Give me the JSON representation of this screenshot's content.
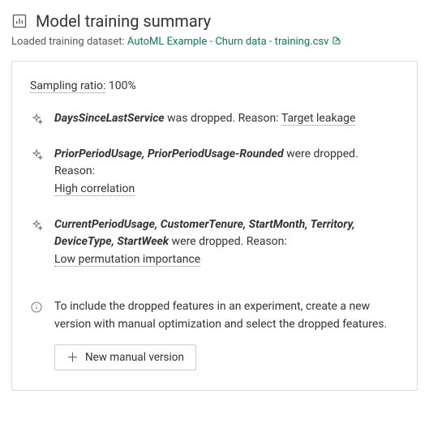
{
  "header": {
    "title": "Model training summary",
    "dataset_label": "Loaded training dataset:",
    "dataset_name": "AutoML Example - Churn data - training.csv"
  },
  "sampling": {
    "label": "Sampling ratio:",
    "value": "100%"
  },
  "drops": [
    {
      "features": "DaysSinceLastService",
      "verb": "was dropped. Reason:",
      "reason": "Target leakage",
      "reason_inline": true
    },
    {
      "features": "PriorPeriodUsage, PriorPeriodUsage-Rounded",
      "verb": "were dropped. Reason:",
      "reason": "High correlation",
      "reason_inline": false
    },
    {
      "features": "CurrentPeriodUsage, CustomerTenure, StartMonth, Territory, DeviceType, StartWeek",
      "verb": "were dropped. Reason:",
      "reason": "Low permutation importance",
      "reason_inline": false
    }
  ],
  "info": {
    "text": "To include the dropped features in an experiment, create a new version with manual optimization and select the dropped features.",
    "button_label": "New manual version"
  }
}
